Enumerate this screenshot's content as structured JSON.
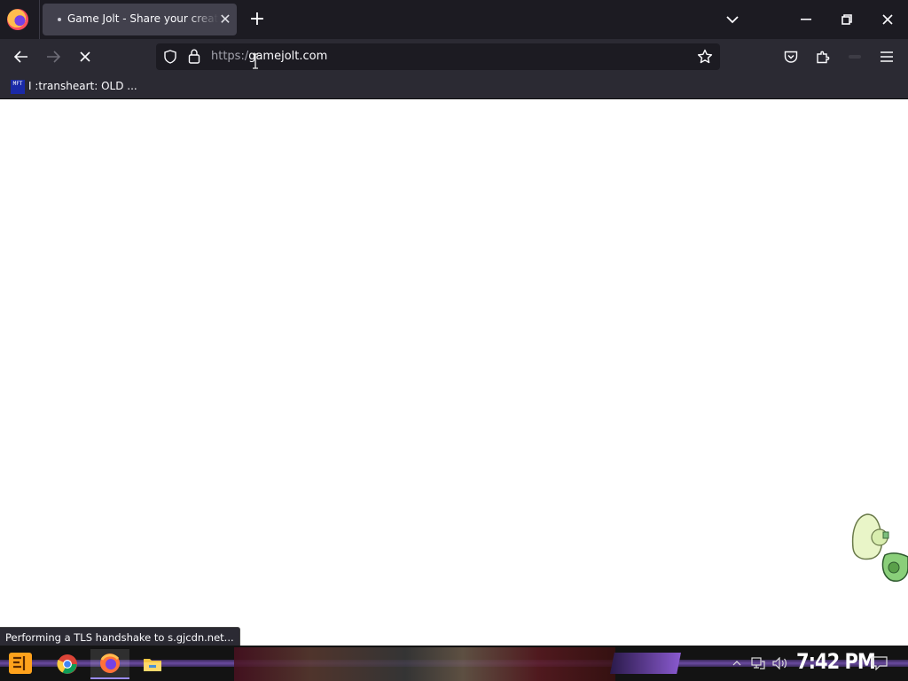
{
  "browser": {
    "tab": {
      "title": "Game Jolt - Share your creations"
    },
    "url": {
      "scheme": "https:/",
      "host": "gamejolt.com"
    },
    "bookmarks": [
      {
        "favicon_text": "MFT",
        "label": "I :transheart: OLD ..."
      }
    ]
  },
  "status_bar": {
    "text": "Performing a TLS handshake to s.gjcdn.net..."
  },
  "taskbar": {
    "apps": [
      "chrome-icon",
      "firefox-icon",
      "file-explorer-icon"
    ],
    "active_app": "firefox-icon",
    "clock": "7:42 PM"
  },
  "colors": {
    "chrome_bg": "#1c1b22",
    "toolbar_bg": "#2b2a33",
    "tab_active": "#42414d",
    "taskbar_accent": "#6a4aa0"
  }
}
